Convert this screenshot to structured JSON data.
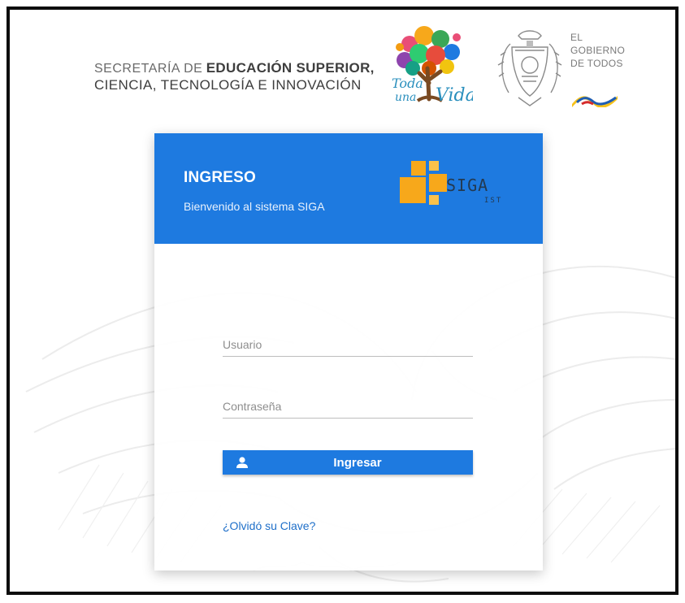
{
  "header": {
    "secretaria": {
      "line1_prefix": "SECRETARÍA DE",
      "line1_bold": "EDUCACIÓN SUPERIOR,",
      "line2": "CIENCIA, TECNOLOGÍA E INNOVACIÓN"
    },
    "tree_logo": {
      "text1": "Toda",
      "text2": "una",
      "text3": "Vida"
    },
    "gobierno": {
      "line1": "EL",
      "line2": "GOBIERNO",
      "line3": "DE TODOS"
    }
  },
  "card": {
    "title": "INGRESO",
    "subtitle": "Bienvenido al sistema SIGA",
    "logo_text": "SIGA",
    "logo_subtext": "IST",
    "header_color": "#1e7ae0"
  },
  "form": {
    "username_placeholder": "Usuario",
    "password_placeholder": "Contraseña",
    "submit_label": "Ingresar",
    "submit_icon": "user-icon",
    "forgot_label": "¿Olvidó su Clave?"
  },
  "colors": {
    "primary": "#1e7ae0",
    "logo_orange": "#f7a81b",
    "link": "#1e6fc9"
  }
}
